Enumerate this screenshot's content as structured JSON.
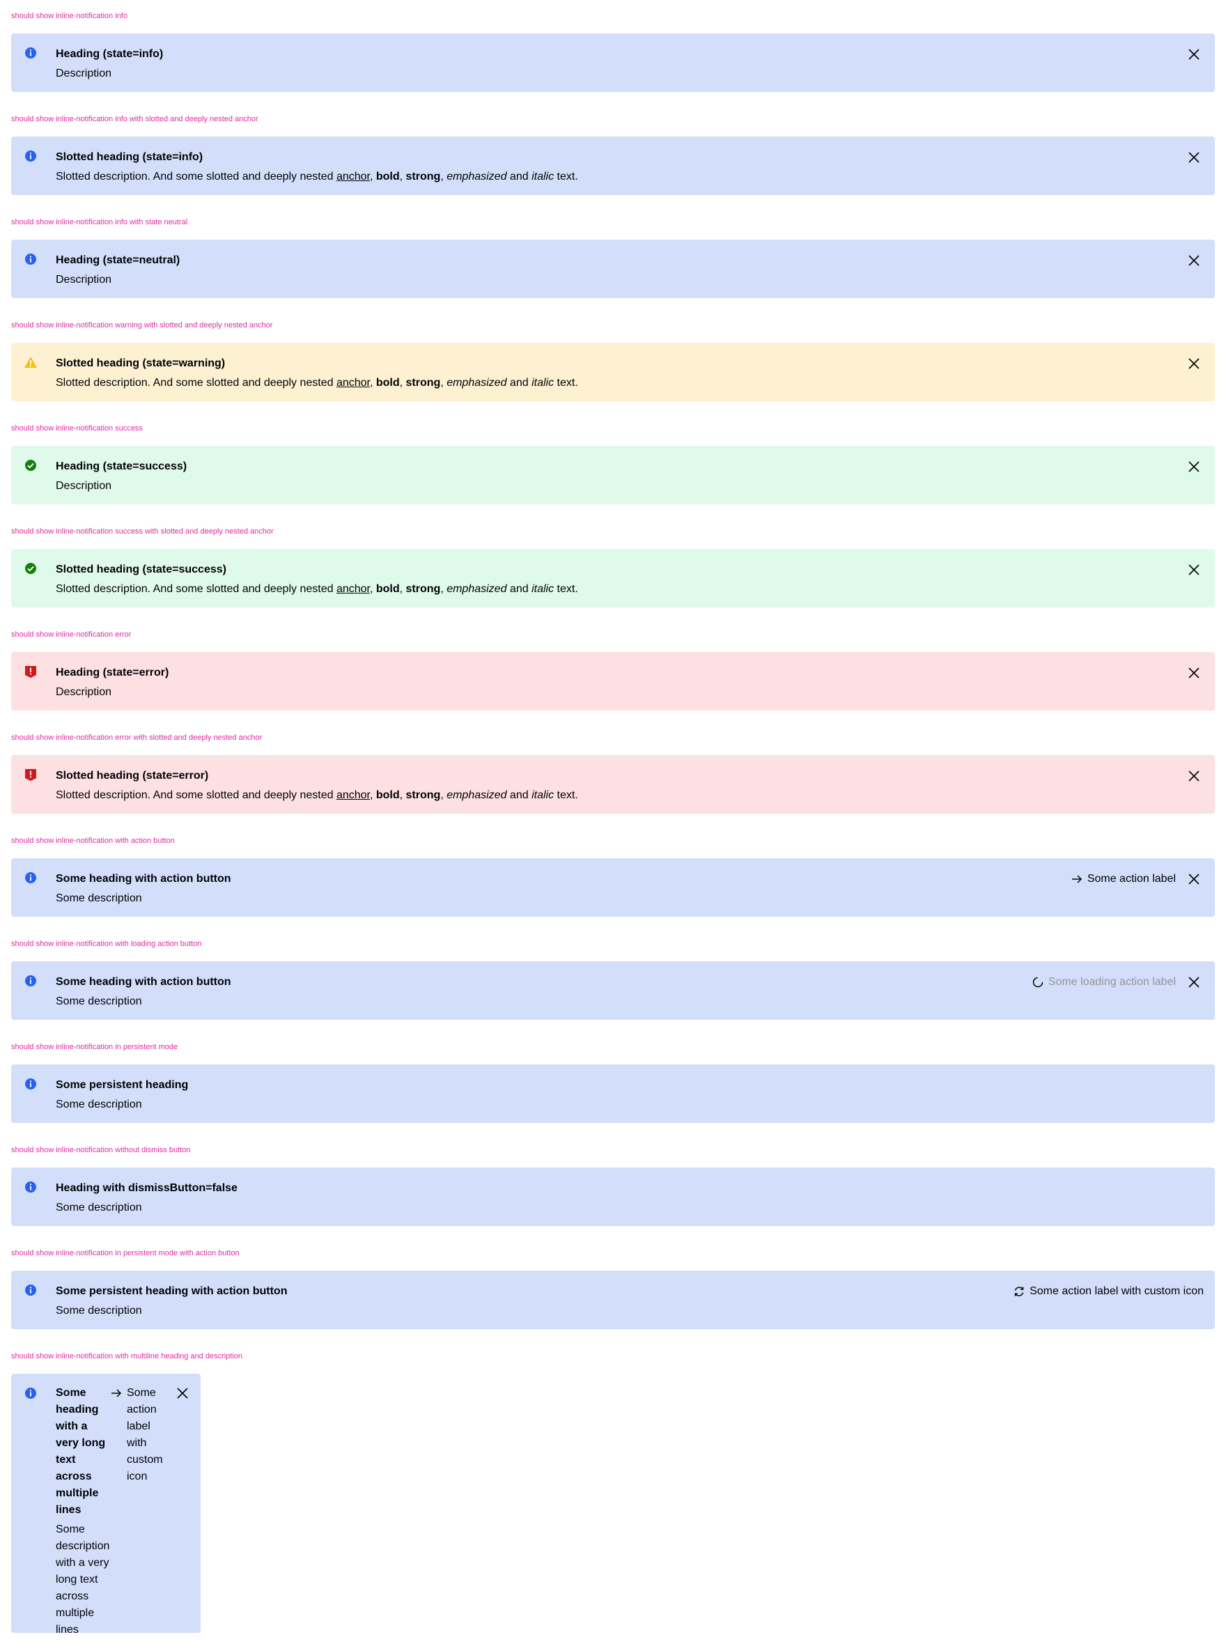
{
  "colors": {
    "label": "#de2ba0",
    "info_bg": "#d3defb",
    "warning_bg": "#fdf1d2",
    "success_bg": "#dffaea",
    "error_bg": "#fde0e2",
    "info_icon": "#2762ec",
    "warning_icon": "#f2c11c",
    "success_icon": "#197e10",
    "error_icon": "#cc1922"
  },
  "rich_description": {
    "prefix": "Slotted description. And some slotted and deeply nested ",
    "anchor": "anchor",
    "sep1": ", ",
    "bold": "bold",
    "sep2": ", ",
    "strong": "strong",
    "sep3": ", ",
    "emphasized": "emphasized",
    "and1": " and ",
    "italic": "italic",
    "suffix": " text."
  },
  "sections": [
    {
      "label": "should show inline-notification info",
      "state": "info",
      "heading": "Heading (state=info)",
      "description": "Description"
    },
    {
      "label": "should show inline-notification info with slotted and deeply nested anchor",
      "state": "info",
      "heading": "Slotted heading (state=info)"
    },
    {
      "label": "should show inline-notification info with state neutral",
      "state": "neutral",
      "heading": "Heading (state=neutral)",
      "description": "Description"
    },
    {
      "label": "should show inline-notification warning with slotted and deeply nested anchor",
      "state": "warning",
      "heading": "Slotted heading (state=warning)"
    },
    {
      "label": "should show inline-notification success",
      "state": "success",
      "heading": "Heading (state=success)",
      "description": "Description"
    },
    {
      "label": "should show inline-notification success with slotted and deeply nested anchor",
      "state": "success",
      "heading": "Slotted heading (state=success)"
    },
    {
      "label": "should show inline-notification error",
      "state": "error",
      "heading": "Heading (state=error)",
      "description": "Description"
    },
    {
      "label": "should show inline-notification error with slotted and deeply nested anchor",
      "state": "error",
      "heading": "Slotted heading (state=error)"
    },
    {
      "label": "should show inline-notification with action button",
      "state": "info",
      "heading": "Some heading with action button",
      "description": "Some description",
      "action": {
        "label": "Some action label",
        "icon": "arrow-right-icon"
      }
    },
    {
      "label": "should show inline-notification with loading action button",
      "state": "info",
      "heading": "Some heading with action button",
      "description": "Some description",
      "action": {
        "label": "Some loading action label",
        "icon": "spinner-icon"
      }
    },
    {
      "label": "should show inline-notification in persistent mode",
      "state": "info",
      "heading": "Some persistent heading",
      "description": "Some description"
    },
    {
      "label": "should show inline-notification without dismiss button",
      "state": "info",
      "heading": "Heading with dismissButton=false",
      "description": "Some description"
    },
    {
      "label": "should show inline-notification in persistent mode with action button",
      "state": "info",
      "heading": "Some persistent heading with action button",
      "description": "Some description",
      "action": {
        "label": "Some action label with custom icon",
        "icon": "reset-icon"
      }
    },
    {
      "label": "should show inline-notification with multiline heading and description",
      "state": "info",
      "heading": "Some heading with a very long text across multiple lines",
      "description": "Some description with a very long text across multiple lines",
      "action": {
        "label": "Some action label with custom icon",
        "icon": "arrow-right-icon"
      }
    }
  ]
}
